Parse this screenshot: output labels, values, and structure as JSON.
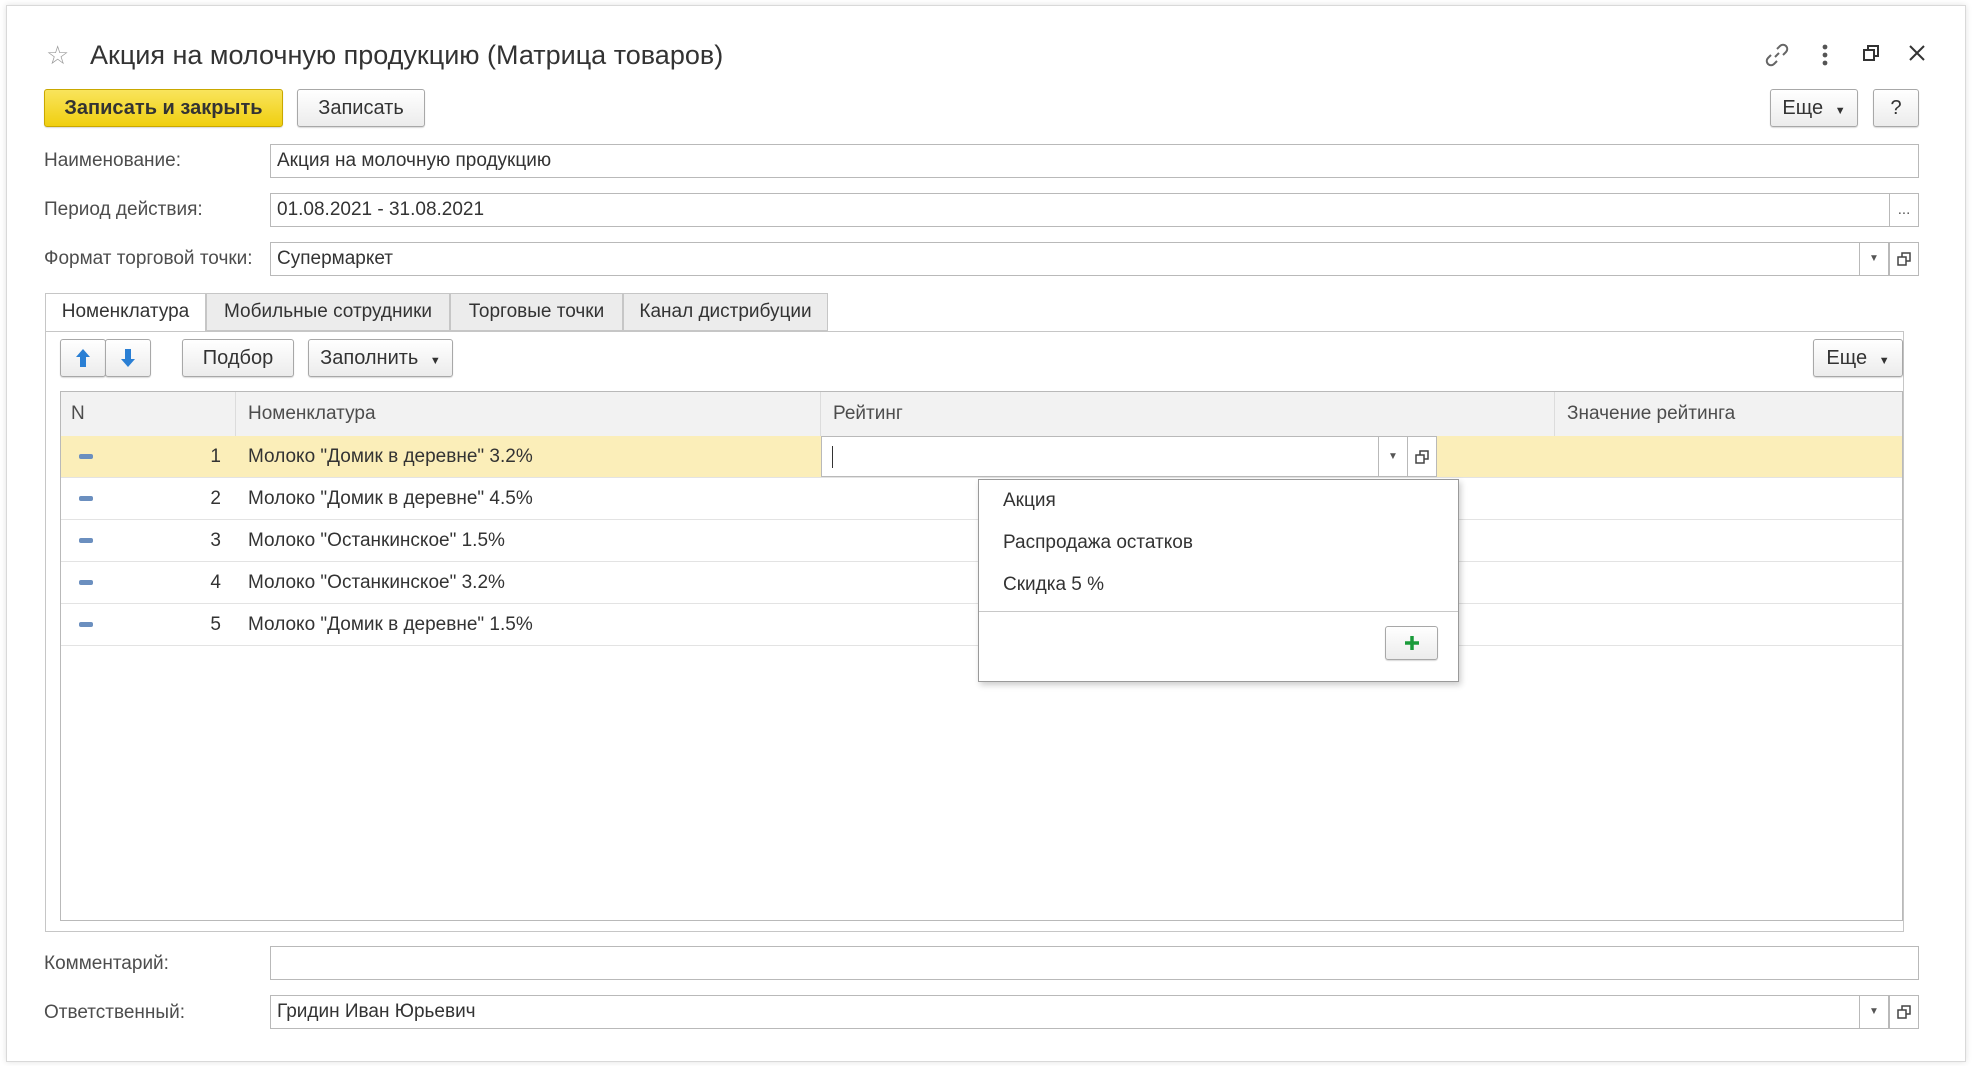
{
  "window": {
    "title": "Акция на молочную продукцию (Матрица товаров)",
    "controls": [
      "link-icon",
      "more-icon",
      "restore-icon",
      "close-icon"
    ]
  },
  "toolbar": {
    "save_close_label": "Записать и закрыть",
    "save_label": "Записать",
    "more_label": "Еще",
    "help_label": "?"
  },
  "form": {
    "name_label": "Наименование:",
    "name_value": "Акция на молочную продукцию",
    "period_label": "Период действия:",
    "period_value": "01.08.2021 - 31.08.2021",
    "period_button": "...",
    "format_label": "Формат торговой точки:",
    "format_value": "Супермаркет",
    "comment_label": "Комментарий:",
    "comment_value": "",
    "responsible_label": "Ответственный:",
    "responsible_value": "Гридин Иван Юрьевич"
  },
  "tabs": [
    {
      "label": "Номенклатура",
      "active": true
    },
    {
      "label": "Мобильные сотрудники",
      "active": false
    },
    {
      "label": "Торговые точки",
      "active": false
    },
    {
      "label": "Канал дистрибуции",
      "active": false
    }
  ],
  "table_toolbar": {
    "up_icon": "arrow-up-icon",
    "down_icon": "arrow-down-icon",
    "pick_label": "Подбор",
    "fill_label": "Заполнить",
    "more_label": "Еще"
  },
  "table": {
    "columns": [
      "N",
      "Номенклатура",
      "Рейтинг",
      "Значение рейтинга"
    ],
    "rows": [
      {
        "n": "1",
        "item": "Молоко \"Домик в деревне\" 3.2%",
        "rating": "",
        "value": ""
      },
      {
        "n": "2",
        "item": "Молоко \"Домик в деревне\" 4.5%",
        "rating": "",
        "value": ""
      },
      {
        "n": "3",
        "item": "Молоко \"Останкинское\" 1.5%",
        "rating": "",
        "value": ""
      },
      {
        "n": "4",
        "item": "Молоко \"Останкинское\" 3.2%",
        "rating": "",
        "value": ""
      },
      {
        "n": "5",
        "item": "Молоко \"Домик в деревне\" 1.5%",
        "rating": "",
        "value": ""
      }
    ]
  },
  "dropdown": {
    "items": [
      "Акция",
      "Распродажа остатков",
      "Скидка 5 %"
    ],
    "add_icon": "plus-icon"
  },
  "colors": {
    "primary_button": "#f0cf10",
    "selected_row": "#fbeeb9",
    "arrow_blue": "#2a7fd4",
    "add_green": "#1a9b3a"
  }
}
